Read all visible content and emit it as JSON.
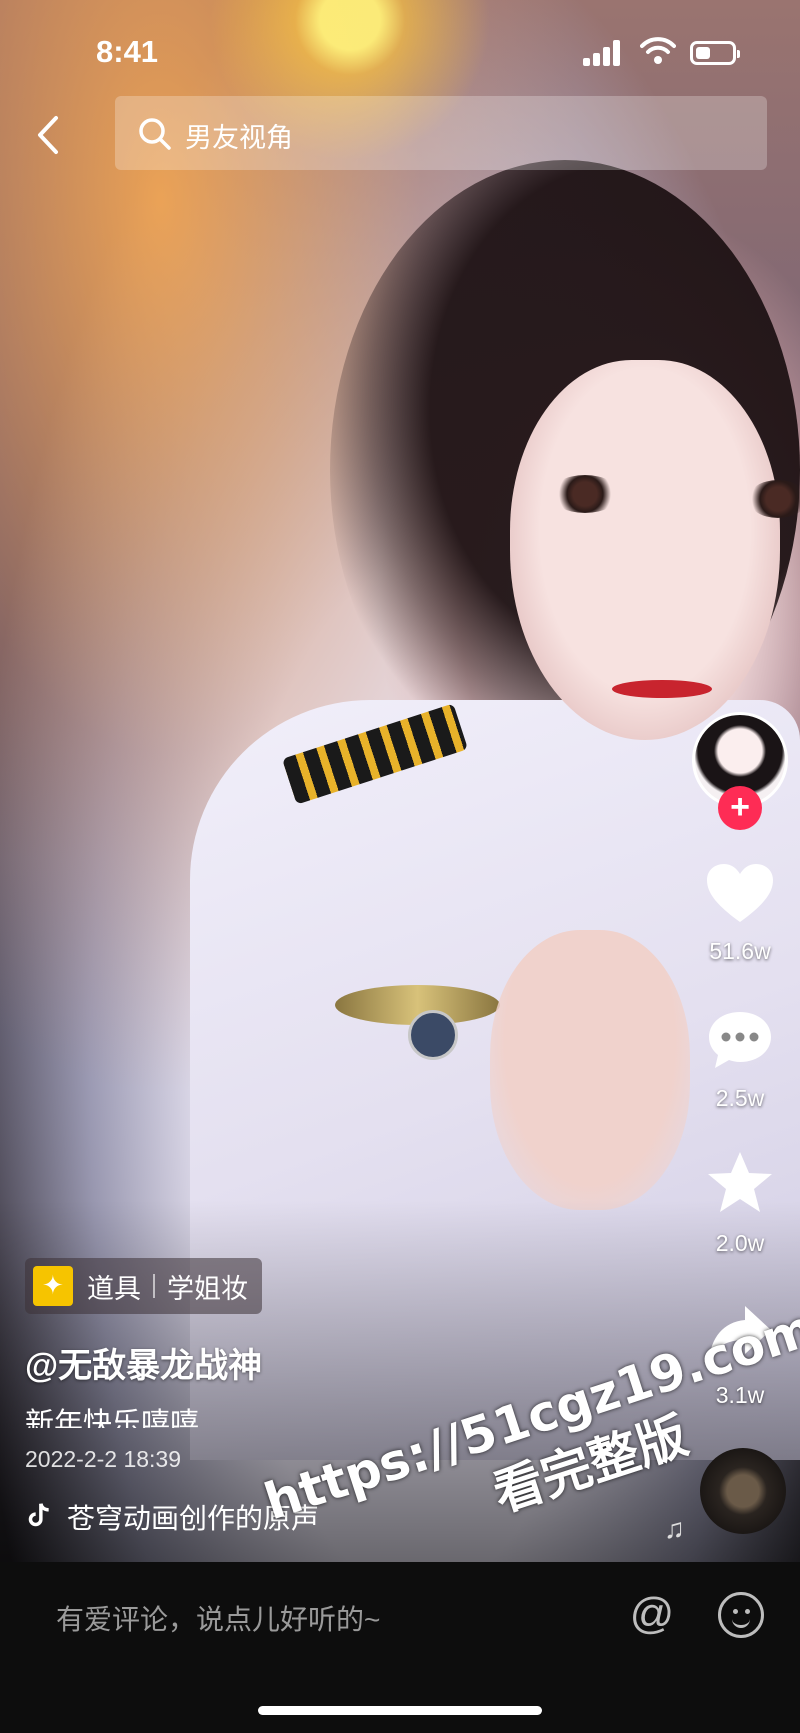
{
  "status_bar": {
    "time": "8:41"
  },
  "search": {
    "query": "男友视角"
  },
  "right_rail": {
    "likes": "51.6w",
    "comments": "2.5w",
    "favorites": "2.0w",
    "shares": "3.1w"
  },
  "video_info": {
    "prop_label": "道具",
    "prop_name": "学姐妆",
    "author": "@无敌暴龙战神",
    "caption": "新年快乐嘻嘻",
    "date": "2022-2-2 18:39",
    "sound": "苍穹动画创作的原声"
  },
  "watermark": {
    "url": "https://51cgz19.com",
    "text": "看完整版"
  },
  "comment_bar": {
    "placeholder": "有爱评论，说点儿好听的~"
  },
  "colors": {
    "accent": "#fe2c55",
    "prop_icon": "#f6c400"
  }
}
